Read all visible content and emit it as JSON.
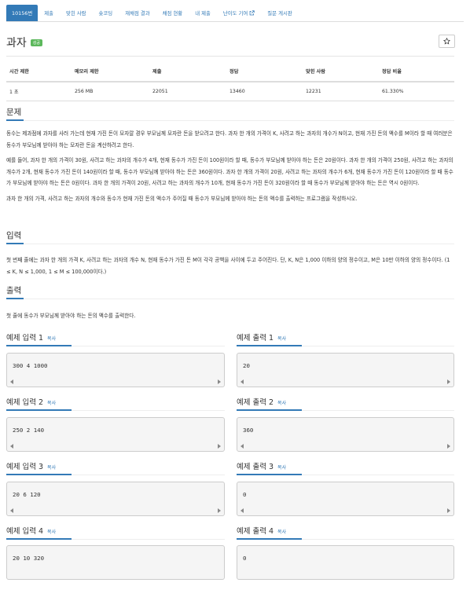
{
  "tabs": [
    {
      "label": "10156번",
      "active": true
    },
    {
      "label": "제출"
    },
    {
      "label": "맞힌 사람"
    },
    {
      "label": "숏코딩"
    },
    {
      "label": "재채점 결과"
    },
    {
      "label": "채점 현황"
    },
    {
      "label": "내 제출"
    },
    {
      "label": "난이도 기여"
    },
    {
      "label": "질문 게시판"
    }
  ],
  "problem": {
    "title": "과자",
    "badge": "성공"
  },
  "info": {
    "headers": [
      "시간 제한",
      "메모리 제한",
      "제출",
      "정답",
      "맞힌 사람",
      "정답 비율"
    ],
    "values": [
      "1 초",
      "256 MB",
      "22051",
      "13460",
      "12231",
      "61.330%"
    ]
  },
  "sections": {
    "description": "문제",
    "input": "입력",
    "output": "출력"
  },
  "description": [
    "동수는 제과점에 과자를 사러 가는데 현재 가진 돈이 모자랄 경우 부모님께 모자란 돈을 받으려고 한다. 과자 한 개의 가격이 K, 사려고 하는 과자의 개수가 N이고, 현재 가진 돈의 액수를 M이라 할 때 여러분은 동수가 부모님께 받아야 하는 모자란 돈을 계산하려고 한다.",
    "예를 들어, 과자 한 개의 가격이 30원, 사려고 하는 과자의 개수가 4개, 현재 동수가 가진 돈이 100원이라 할 때, 동수가 부모님께 받아야 하는 돈은 20원이다. 과자 한 개의 가격이 250원, 사려고 하는 과자의 개수가 2개, 현재 동수가 가진 돈이 140원이라 할 때, 동수가 부모님께 받아야 하는 돈은 360원이다. 과자 한 개의 가격이 20원, 사려고 하는 과자의 개수가 6개, 현재 동수가 가진 돈이 120원이라 할 때 동수가 부모님께 받아야 하는 돈은 0원이다. 과자 한 개의 가격이 20원, 사려고 하는 과자의 개수가 10개, 현재 동수가 가진 돈이 320원이라 할 때 동수가 부모님께 받아야 하는 돈은 역시 0원이다.",
    "과자 한 개의 가격, 사려고 하는 과자의 개수와 동수가 현재 가진 돈의 액수가 주어질 때 동수가 부모님께 받아야 하는 돈의 액수를 출력하는 프로그램을 작성하시오."
  ],
  "input_text": "첫 번째 줄에는 과자 한 개의 가격 K, 사려고 하는 과자의 개수 N, 현재 동수가 가진 돈 M이 각각 공백을 사이에 두고 주어진다. 단, K, N은 1,000 이하의 양의 정수이고, M은 10만 이하의 양의 정수이다. (1 ≤ K, N ≤ 1,000, 1 ≤ M ≤ 100,000이다.)",
  "output_text": "첫 줄에 동수가 부모님께 받아야 하는 돈의 액수를 출력한다.",
  "copy_label": "복사",
  "samples": [
    {
      "in_title": "예제 입력 1",
      "out_title": "예제 출력 1",
      "input": "300 4 1000",
      "output": "20"
    },
    {
      "in_title": "예제 입력 2",
      "out_title": "예제 출력 2",
      "input": "250 2 140",
      "output": "360"
    },
    {
      "in_title": "예제 입력 3",
      "out_title": "예제 출력 3",
      "input": "20 6 120",
      "output": "0"
    },
    {
      "in_title": "예제 입력 4",
      "out_title": "예제 출력 4",
      "input": "20 10 320",
      "output": "0"
    }
  ],
  "colors": {
    "accent": "#337ab7",
    "success": "#5cb85c"
  },
  "icons": {
    "star": "star-icon",
    "external": "external-link-icon"
  }
}
